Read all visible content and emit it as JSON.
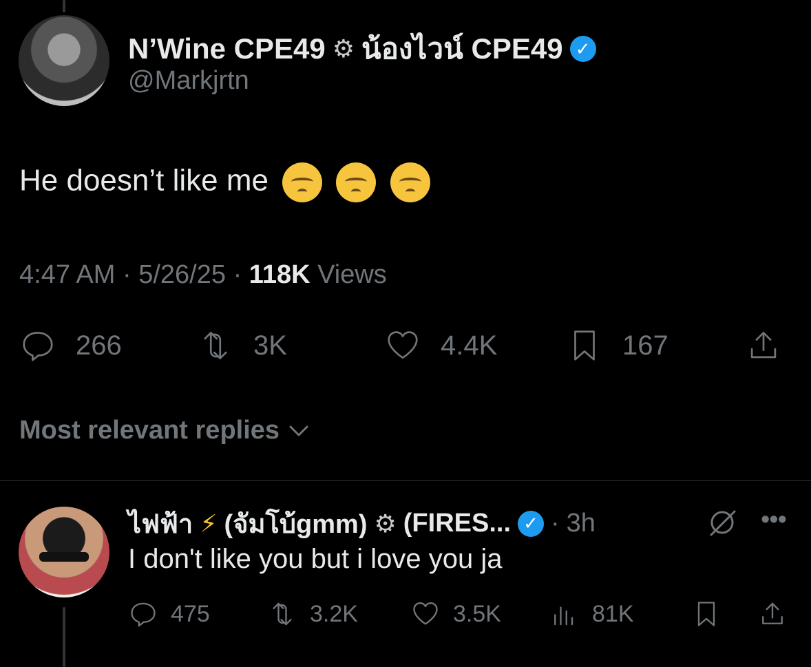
{
  "colors": {
    "background": "#000000",
    "primary_text": "#e7e9ea",
    "secondary_text": "#71767b",
    "verified": "#1d9bf0"
  },
  "post": {
    "display_name_1": "N’Wine CPE49",
    "display_name_2": "น้องไวน์ CPE49",
    "handle": "@Markjrtn",
    "text": "He doesn’t like me",
    "meta_time": "4:47 AM",
    "meta_date": "5/26/25",
    "views_count": "118K",
    "views_label": "Views",
    "actions": {
      "replies": "266",
      "reposts": "3K",
      "likes": "4.4K",
      "bookmarks": "167"
    }
  },
  "sort": {
    "label": "Most relevant replies"
  },
  "reply": {
    "name_part_1": "ไฟฟ้า",
    "name_part_2": "(จัมโบ้gmm)",
    "name_part_3": "(FIRES...",
    "time_separator": "·",
    "time": "3h",
    "text": "I don't like you but i love you ja",
    "actions": {
      "replies": "475",
      "reposts": "3.2K",
      "likes": "3.5K",
      "views": "81K"
    }
  }
}
